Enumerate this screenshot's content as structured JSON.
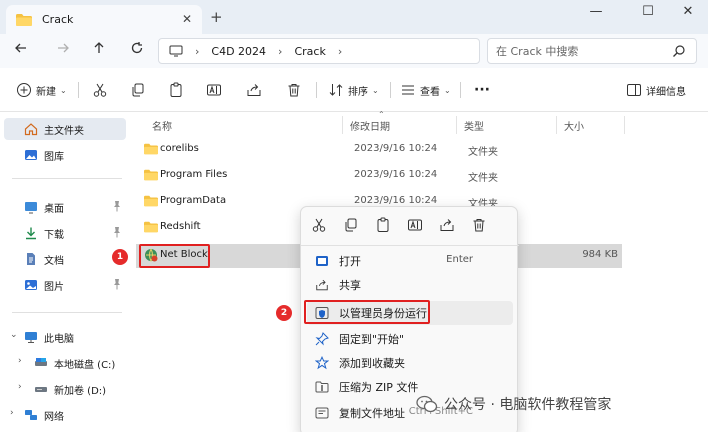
{
  "window": {
    "tab_title": "Crack",
    "tab_close": "✕",
    "tab_add": "+",
    "minimize": "—",
    "maximize": "☐",
    "close": "✕"
  },
  "nav": {
    "breadcrumb": [
      "C4D 2024",
      "Crack"
    ],
    "sep": "›",
    "search_placeholder": "在 Crack 中搜索"
  },
  "toolbar": {
    "new_label": "新建",
    "sort_label": "排序",
    "view_label": "查看",
    "more_label": "···",
    "details_label": "详细信息"
  },
  "sidebar": {
    "items": [
      {
        "label": "主文件夹"
      },
      {
        "label": "图库"
      },
      {
        "label": "桌面"
      },
      {
        "label": "下载"
      },
      {
        "label": "文档"
      },
      {
        "label": "图片"
      },
      {
        "label": "此电脑"
      },
      {
        "label": "本地磁盘 (C:)"
      },
      {
        "label": "新加卷 (D:)"
      },
      {
        "label": "网络"
      }
    ]
  },
  "list": {
    "headers": {
      "name": "名称",
      "modified": "修改日期",
      "type": "类型",
      "size": "大小"
    },
    "rows": [
      {
        "name": "corelibs",
        "date": "2023/9/16 10:24",
        "type": "文件夹",
        "size": ""
      },
      {
        "name": "Program Files",
        "date": "2023/9/16 10:24",
        "type": "文件夹",
        "size": ""
      },
      {
        "name": "ProgramData",
        "date": "2023/9/16 10:24",
        "type": "文件夹",
        "size": ""
      },
      {
        "name": "Redshift",
        "date": "",
        "type": "",
        "size": ""
      },
      {
        "name": "Net Block",
        "date": "",
        "type": "",
        "size": "984 KB"
      }
    ]
  },
  "context_menu": {
    "items": [
      {
        "label": "打开",
        "shortcut": "Enter"
      },
      {
        "label": "共享",
        "shortcut": ""
      },
      {
        "label": "以管理员身份运行",
        "shortcut": ""
      },
      {
        "label": "固定到\"开始\"",
        "shortcut": ""
      },
      {
        "label": "添加到收藏夹",
        "shortcut": ""
      },
      {
        "label": "压缩为 ZIP 文件",
        "shortcut": ""
      },
      {
        "label": "复制文件地址",
        "shortcut": "Ctrl+Shift+C"
      }
    ]
  },
  "annotations": {
    "step1": "1",
    "step2": "2"
  },
  "watermark": {
    "text": "公众号 · 电脑软件教程管家"
  },
  "colors": {
    "accent": "#0067c0",
    "highlight_red": "#e02020",
    "folder": "#f5c242"
  }
}
